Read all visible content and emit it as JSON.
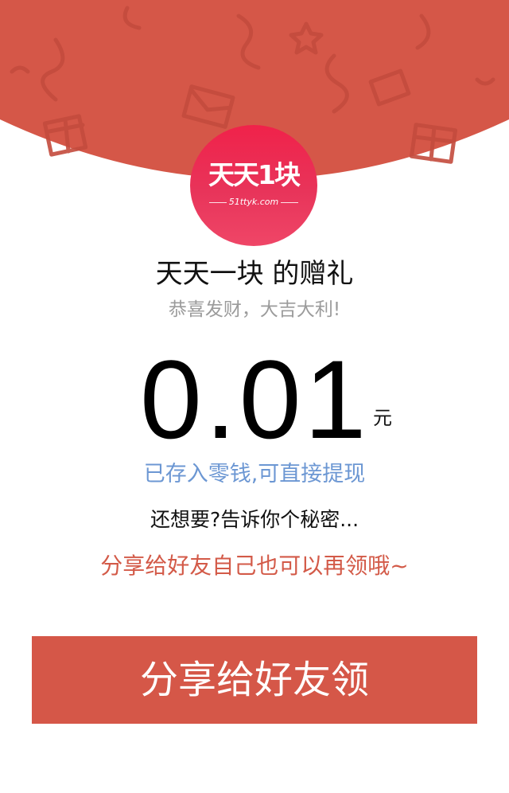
{
  "colors": {
    "header_red": "#d55748",
    "logo_red": "#ec2a50",
    "amount_black": "#000000",
    "saved_blue": "#6c97d3",
    "share_red": "#d35a48",
    "button_red": "#d55748"
  },
  "logo": {
    "brand": "天天1块",
    "domain": "51ttyk.com"
  },
  "gift": {
    "title": "天天一块 的赠礼",
    "subtitle": "恭喜发财，大吉大利!",
    "amount": "0.01",
    "unit": "元",
    "status": "已存入零钱,可直接提现",
    "secret": "还想要?告诉你个秘密...",
    "share_hint": "分享给好友自己也可以再领哦~"
  },
  "share_button": {
    "label": "分享给好友领"
  }
}
